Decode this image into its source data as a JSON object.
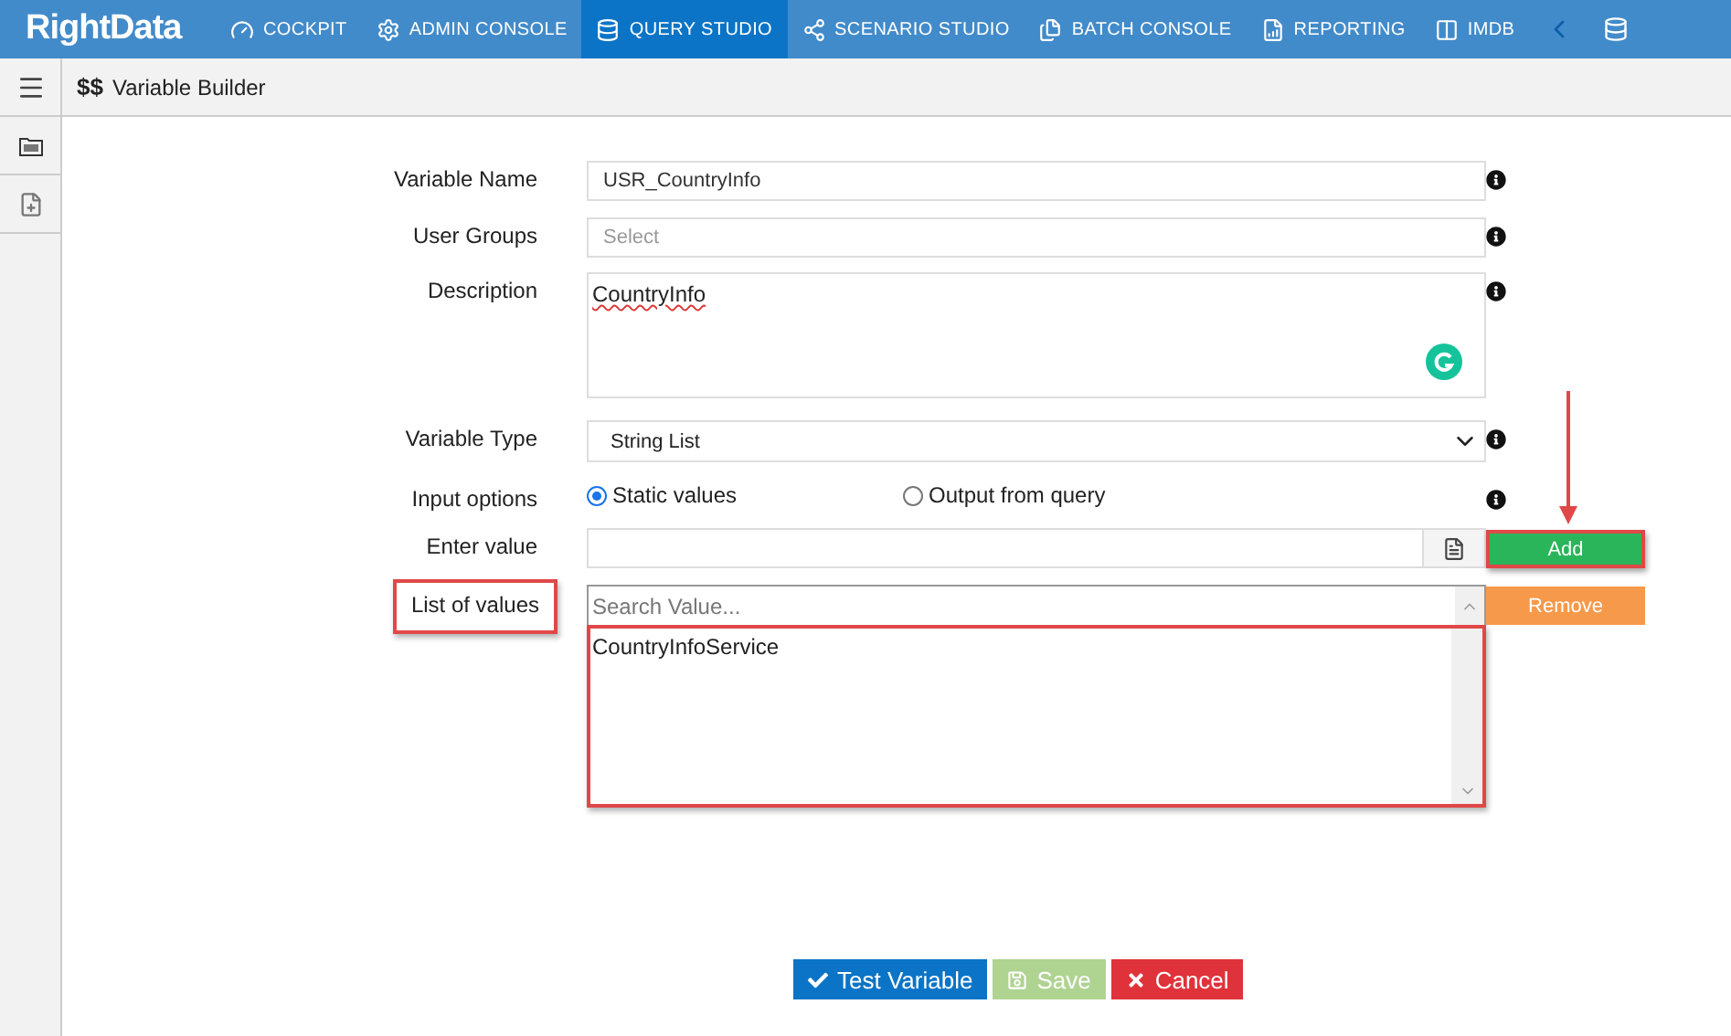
{
  "logo": "RightData",
  "nav": [
    {
      "label": "COCKPIT",
      "selected": false
    },
    {
      "label": "ADMIN CONSOLE",
      "selected": false
    },
    {
      "label": "QUERY STUDIO",
      "selected": true
    },
    {
      "label": "SCENARIO STUDIO",
      "selected": false
    },
    {
      "label": "BATCH CONSOLE",
      "selected": false
    },
    {
      "label": "REPORTING",
      "selected": false
    },
    {
      "label": "IMDB",
      "selected": false
    }
  ],
  "page": {
    "mark": "$$",
    "title": "Variable Builder"
  },
  "form": [
    {
      "kind": "text",
      "label": "Variable Name",
      "value": "USR_CountryInfo",
      "info": true
    },
    {
      "kind": "text",
      "label": "User Groups",
      "placeholder": "Select",
      "info": true
    },
    {
      "kind": "textarea",
      "label": "Description",
      "value": "CountryInfo",
      "info": true
    },
    {
      "kind": "select",
      "label": "Variable Type",
      "value": "String List",
      "info": true
    },
    {
      "kind": "radio",
      "label": "Input options",
      "info": true,
      "options": [
        {
          "label": "Static values",
          "selected": true
        },
        {
          "label": "Output from query",
          "selected": false
        }
      ]
    },
    {
      "kind": "entry",
      "label": "Enter value",
      "info": false,
      "action": {
        "kind": "add",
        "label": "Add",
        "highlighted": true
      }
    },
    {
      "kind": "list",
      "label": "List of values",
      "info": false,
      "label_highlighted": true,
      "list_highlighted": true,
      "placeholder": "Search Value...",
      "items": [
        "CountryInfoService"
      ],
      "action": {
        "kind": "remove",
        "label": "Remove",
        "highlighted": false
      }
    }
  ],
  "buttons": [
    {
      "kind": "test",
      "label": "Test Variable",
      "disabled": false
    },
    {
      "kind": "save",
      "label": "Save",
      "disabled": true
    },
    {
      "kind": "cancel",
      "label": "Cancel",
      "disabled": false
    }
  ]
}
